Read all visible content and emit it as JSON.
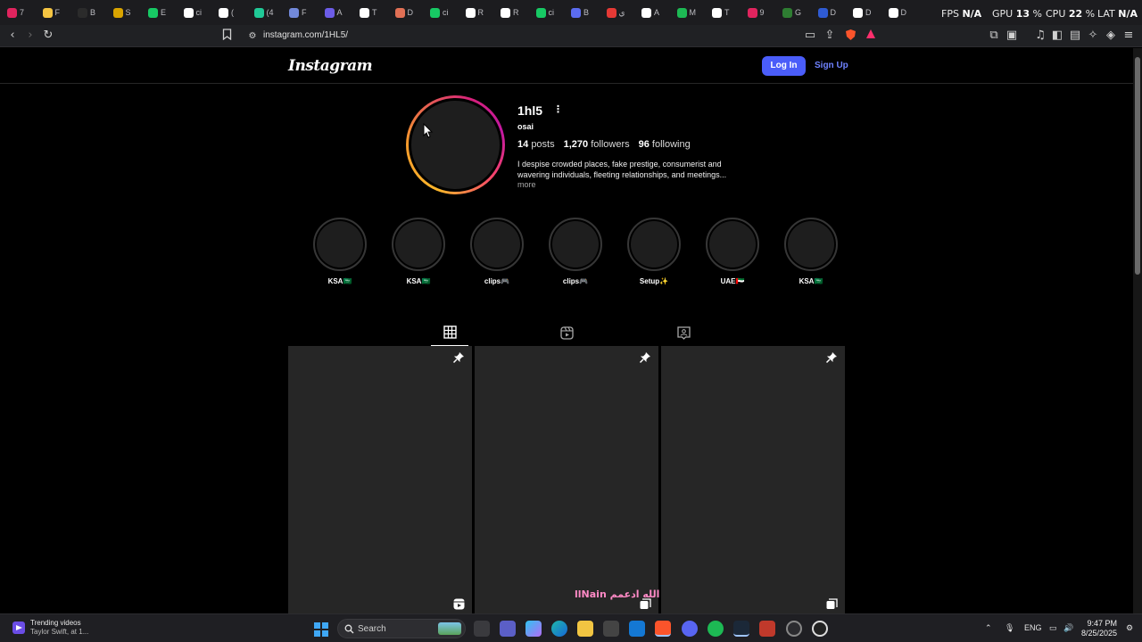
{
  "browser": {
    "tabs": [
      {
        "label": "7",
        "color": "#e0245e"
      },
      {
        "label": "F",
        "color": "#f5c542"
      },
      {
        "label": "B",
        "color": "#2b2b2b"
      },
      {
        "label": "S",
        "color": "#d9a400"
      },
      {
        "label": "E",
        "color": "#17c964"
      },
      {
        "label": "ci",
        "color": "#ffffff"
      },
      {
        "label": "(",
        "color": "#ffffff"
      },
      {
        "label": "(4",
        "color": "#20c997"
      },
      {
        "label": "F",
        "color": "#7289da"
      },
      {
        "label": "A",
        "color": "#6c5ce7"
      },
      {
        "label": "T",
        "color": "#ffffff"
      },
      {
        "label": "D",
        "color": "#e17055"
      },
      {
        "label": "ci",
        "color": "#17c964"
      },
      {
        "label": "R",
        "color": "#ffffff"
      },
      {
        "label": "R",
        "color": "#ffffff"
      },
      {
        "label": "ci",
        "color": "#17c964"
      },
      {
        "label": "B",
        "color": "#5b6cf0"
      },
      {
        "label": "ي",
        "color": "#e53935"
      },
      {
        "label": "A",
        "color": "#ffffff"
      },
      {
        "label": "M",
        "color": "#1db954"
      },
      {
        "label": "T",
        "color": "#ffffff"
      },
      {
        "label": "9",
        "color": "#e0245e"
      },
      {
        "label": "G",
        "color": "#2e7d32"
      },
      {
        "label": "D",
        "color": "#2f5bd3"
      },
      {
        "label": "D",
        "color": "#ffffff"
      },
      {
        "label": "D",
        "color": "#ffffff"
      }
    ],
    "overlay": {
      "fps_label": "FPS",
      "fps_value": "N/A",
      "gpu_label": "GPU",
      "gpu_value": "13",
      "cpu_label": "CPU",
      "cpu_value": "22",
      "lat_label": "LAT",
      "lat_value": "N/A"
    },
    "url": "instagram.com/1HL5/"
  },
  "instagram": {
    "logo": "Instagram",
    "login_label": "Log In",
    "signup_label": "Sign Up",
    "profile": {
      "username": "1hl5",
      "options_icon": "⋮",
      "full_name": "osai",
      "posts_count": "14",
      "posts_label": "posts",
      "followers_count": "1,270",
      "followers_label": "followers",
      "following_count": "96",
      "following_label": "following",
      "bio": "I despise crowded places, fake prestige, consumerist and wavering individuals, fleeting relationships, and meetings...",
      "bio_more": "more"
    },
    "highlights": [
      {
        "label": "KSA🇸🇦"
      },
      {
        "label": "KSA🇸🇦"
      },
      {
        "label": "clips🎮"
      },
      {
        "label": "clips🎮"
      },
      {
        "label": "Setup✨"
      },
      {
        "label": "UAE🇦🇪"
      },
      {
        "label": "KSA🇸🇦"
      }
    ],
    "tabs": [
      {
        "name": "posts-grid-icon"
      },
      {
        "name": "reels-icon"
      },
      {
        "name": "tagged-icon"
      }
    ],
    "posts": [
      {
        "pinned": true,
        "type": "reel-icon",
        "caption": ""
      },
      {
        "pinned": true,
        "type": "carousel-icon",
        "caption": "llNain الله ادعمم"
      },
      {
        "pinned": true,
        "type": "carousel-icon",
        "caption": ""
      }
    ]
  },
  "taskbar": {
    "widget_title": "Trending videos",
    "widget_sub": "Taylor Swift, at 1...",
    "search_label": "Search",
    "language": "ENG",
    "time": "9:47 PM",
    "date": "8/25/2025"
  }
}
